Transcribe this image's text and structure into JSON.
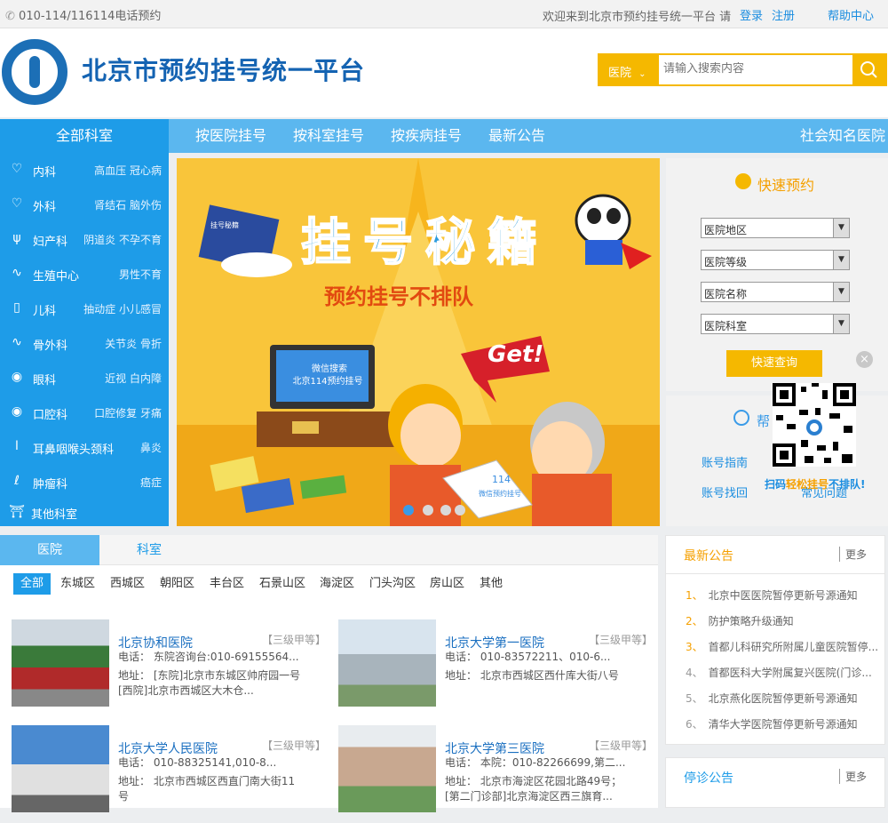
{
  "topbar": {
    "phone": "010-114/116114电话预约",
    "welcome": "欢迎来到北京市预约挂号统一平台 请",
    "login": "登录",
    "register": "注册",
    "help": "帮助中心"
  },
  "header": {
    "title": "北京市预约挂号统一平台",
    "search_type": "医院",
    "search_placeholder": "请输入搜索内容"
  },
  "nav": {
    "all_departments": "全部科室",
    "items": [
      "按医院挂号",
      "按科室挂号",
      "按疾病挂号",
      "最新公告"
    ],
    "right": "社会知名医院"
  },
  "departments": [
    {
      "name": "内科",
      "sub": "高血压 冠心病",
      "icon": "heart-rate-icon"
    },
    {
      "name": "外科",
      "sub": "肾结石 脑外伤",
      "icon": "heart-icon"
    },
    {
      "name": "妇产科",
      "sub": "阴道炎 不孕不育",
      "icon": "uterus-icon"
    },
    {
      "name": "生殖中心",
      "sub": "男性不育",
      "icon": "reproduction-icon"
    },
    {
      "name": "儿科",
      "sub": "抽动症 小儿感冒",
      "icon": "baby-bottle-icon"
    },
    {
      "name": "骨外科",
      "sub": "关节炎 骨折",
      "icon": "bone-icon"
    },
    {
      "name": "眼科",
      "sub": "近视 白内障",
      "icon": "eye-icon"
    },
    {
      "name": "口腔科",
      "sub": "口腔修复 牙痛",
      "icon": "mouth-icon"
    },
    {
      "name": "耳鼻咽喉头颈科",
      "sub": "鼻炎",
      "icon": "ear-icon"
    },
    {
      "name": "肿瘤科",
      "sub": "癌症",
      "icon": "tumor-icon"
    },
    {
      "name": "其他科室",
      "sub": "",
      "icon": "medical-kit-icon"
    }
  ],
  "banner": {
    "title": "挂号秘籍",
    "subtitle": "预约挂号不排队",
    "tv_line1": "微信搜索",
    "tv_line2": "北京114预约挂号",
    "get": "Get!",
    "book_label": "挂号秘籍",
    "paper_number": "114",
    "paper_text": "微信预约挂号",
    "dots": 4,
    "active_dot": 1
  },
  "quick": {
    "title": "快速预约",
    "selects": [
      "医院地区",
      "医院等级",
      "医院名称",
      "医院科室"
    ],
    "button": "快速查询"
  },
  "help_box": {
    "title": "帮",
    "links": [
      "账号指南",
      "账号找回",
      "常见问题"
    ],
    "qr_caption_a": "扫码",
    "qr_caption_b": "轻松挂号",
    "qr_caption_c": "不排队!"
  },
  "tabs": [
    "医院",
    "科室"
  ],
  "districts": [
    "全部",
    "东城区",
    "西城区",
    "朝阳区",
    "丰台区",
    "石景山区",
    "海淀区",
    "门头沟区",
    "房山区",
    "其他"
  ],
  "hospitals": [
    {
      "name": "北京协和医院",
      "level": "【三级甲等】",
      "phone": "电话：  东院咨询台:010-69155564...",
      "addr1": "地址：  [东院]北京市东城区帅府园一号",
      "addr2": "[西院]北京市西城区大木仓..."
    },
    {
      "name": "北京大学第一医院",
      "level": "【三级甲等】",
      "phone": "电话：  010-83572211、010-6...",
      "addr1": "地址：  北京市西城区西什库大街八号",
      "addr2": ""
    },
    {
      "name": "北京大学人民医院",
      "level": "【三级甲等】",
      "phone": "电话：  010-88325141,010-8...",
      "addr1": "地址：  北京市西城区西直门南大街11",
      "addr2": "号"
    },
    {
      "name": "北京大学第三医院",
      "level": "【三级甲等】",
      "phone": "电话：  本院：010-82266699,第二...",
      "addr1": "地址：  北京市海淀区花园北路49号；",
      "addr2": "[第二门诊部]北京海淀区西三旗育..."
    }
  ],
  "news": {
    "title": "最新公告",
    "more": "更多",
    "items": [
      {
        "num": "1、",
        "text": "北京中医医院暂停更新号源通知"
      },
      {
        "num": "2、",
        "text": "防护策略升级通知"
      },
      {
        "num": "3、",
        "text": "首都儿科研究所附属儿童医院暂停..."
      },
      {
        "num": "4、",
        "text": "首都医科大学附属复兴医院(门诊..."
      },
      {
        "num": "5、",
        "text": "北京燕化医院暂停更新号源通知"
      },
      {
        "num": "6、",
        "text": "清华大学医院暂停更新号源通知"
      }
    ]
  },
  "stop": {
    "title": "停诊公告",
    "more": "更多"
  },
  "colors": {
    "primary": "#1e9ce8",
    "nav": "#5bb7ef",
    "accent": "#f5b800",
    "title": "#1463b2"
  }
}
